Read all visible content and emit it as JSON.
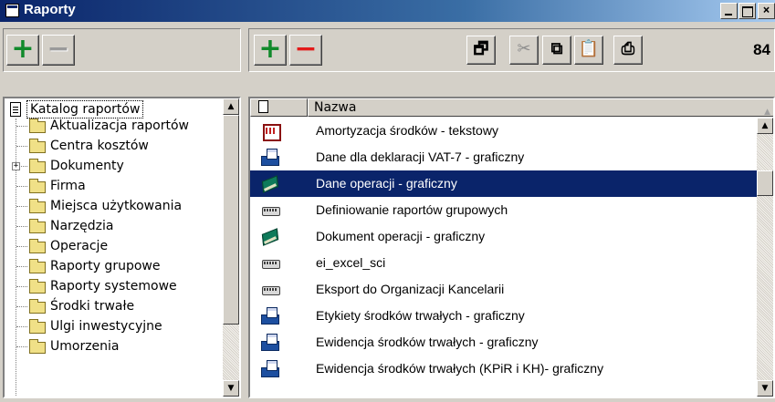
{
  "window": {
    "title": "Raporty",
    "caption_buttons": {
      "close": "×"
    }
  },
  "left_toolbar": {
    "add": "+",
    "remove": "−"
  },
  "right_toolbar": {
    "add": "+",
    "remove": "−",
    "tools": [
      {
        "icon": "properties-icon",
        "glyph": "🗗"
      },
      {
        "icon": "cut-icon",
        "glyph": "✂"
      },
      {
        "icon": "copy-icon",
        "glyph": "⧉"
      },
      {
        "icon": "paste-icon",
        "glyph": "📋"
      },
      {
        "icon": "print-icon",
        "glyph": "⎙"
      }
    ],
    "count": "84"
  },
  "tree": {
    "root_label": "Katalog raportów",
    "items": [
      {
        "label": "Aktualizacja raportów",
        "expandable": false
      },
      {
        "label": "Centra kosztów",
        "expandable": false
      },
      {
        "label": "Dokumenty",
        "expandable": true,
        "expander": "+"
      },
      {
        "label": "Firma",
        "expandable": false
      },
      {
        "label": "Miejsca użytkowania",
        "expandable": false
      },
      {
        "label": "Narzędzia",
        "expandable": false
      },
      {
        "label": "Operacje",
        "expandable": false
      },
      {
        "label": "Raporty grupowe",
        "expandable": false
      },
      {
        "label": "Raporty systemowe",
        "expandable": false
      },
      {
        "label": "Środki trwałe",
        "expandable": false
      },
      {
        "label": "Ulgi inwestycyjne",
        "expandable": false
      },
      {
        "label": "Umorzenia",
        "expandable": false
      }
    ]
  },
  "list": {
    "header_name": "Nazwa",
    "rows": [
      {
        "name": "Amortyzacja środków - tekstowy",
        "icon": "calendar-icon",
        "selected": false
      },
      {
        "name": "Dane dla deklaracji VAT-7 - graficzny",
        "icon": "fax-icon",
        "selected": false
      },
      {
        "name": "Dane operacji - graficzny",
        "icon": "book-icon",
        "selected": true
      },
      {
        "name": "Definiowanie raportów grupowych",
        "icon": "printer-icon",
        "selected": false
      },
      {
        "name": "Dokument operacji - graficzny",
        "icon": "book-icon",
        "selected": false
      },
      {
        "name": "ei_excel_sci",
        "icon": "printer-icon",
        "selected": false
      },
      {
        "name": "Eksport do Organizacji Kancelarii",
        "icon": "printer-icon",
        "selected": false
      },
      {
        "name": "Etykiety środków trwałych - graficzny",
        "icon": "fax-icon",
        "selected": false
      },
      {
        "name": "Ewidencja środków trwałych - graficzny",
        "icon": "fax-icon",
        "selected": false
      },
      {
        "name": "Ewidencja środków trwałych (KPiR i KH)- graficzny",
        "icon": "fax-icon",
        "selected": false
      }
    ]
  },
  "colors": {
    "selection": "#0a246a",
    "titlebar": "#0a246a",
    "add": "#118a2b",
    "remove": "#e31a1a"
  }
}
